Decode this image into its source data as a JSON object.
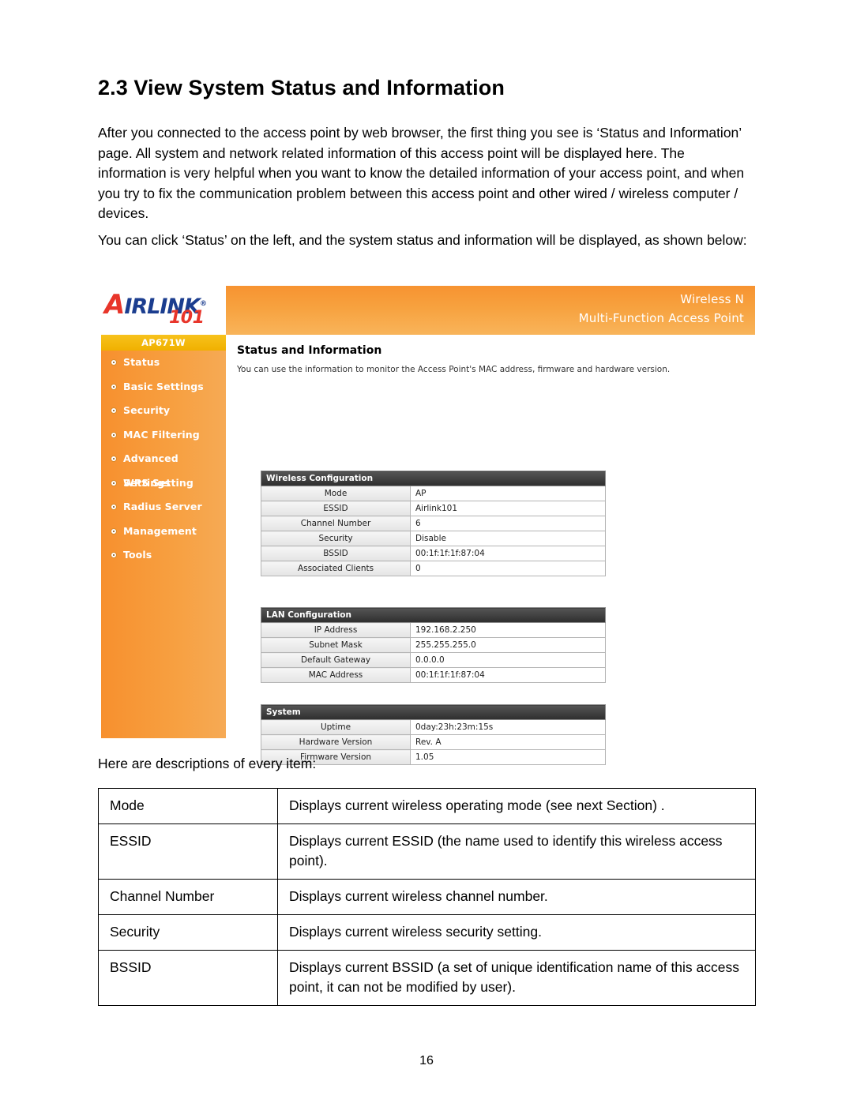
{
  "document": {
    "section_title": "2.3 View System Status and Information",
    "paragraph_1": "After you connected to the access point by web browser, the first thing you see is ‘Status and Information’ page. All system and network related information of this access point will be displayed here. The information is very helpful when you want to know the detailed information of your access point, and when you try to fix the communication problem between this access point and other wired / wireless computer / devices.",
    "paragraph_2": "You can click ‘Status’ on the left, and the system status and information will be displayed, as shown below:",
    "paragraph_3": "Here are descriptions of every item:",
    "page_number": "16"
  },
  "router_ui": {
    "logo": {
      "brand_first_letter": "A",
      "brand_rest": "IR",
      "brand_link": "LINK",
      "brand_number": "101",
      "registered": "®"
    },
    "header": {
      "line1": "Wireless N",
      "line2": "Multi-Function Access Point"
    },
    "sidebar": {
      "model": "AP671W",
      "items": [
        {
          "label": "Status"
        },
        {
          "label": "Basic Settings"
        },
        {
          "label": "Security"
        },
        {
          "label": "MAC Filtering"
        },
        {
          "label": "Advanced Settings"
        },
        {
          "label": "WPS Setting"
        },
        {
          "label": "Radius Server"
        },
        {
          "label": "Management"
        },
        {
          "label": "Tools"
        }
      ]
    },
    "content": {
      "title": "Status and Information",
      "description": "You can use the information to monitor the Access Point's MAC address, firmware and hardware version.",
      "wireless_section": "Wireless Configuration",
      "wireless_rows": [
        {
          "key": "Mode",
          "value": "AP"
        },
        {
          "key": "ESSID",
          "value": "Airlink101"
        },
        {
          "key": "Channel Number",
          "value": "6"
        },
        {
          "key": "Security",
          "value": "Disable"
        },
        {
          "key": "BSSID",
          "value": "00:1f:1f:1f:87:04"
        },
        {
          "key": "Associated Clients",
          "value": "0"
        }
      ],
      "lan_section": "LAN Configuration",
      "lan_rows": [
        {
          "key": "IP Address",
          "value": "192.168.2.250"
        },
        {
          "key": "Subnet Mask",
          "value": "255.255.255.0"
        },
        {
          "key": "Default Gateway",
          "value": "0.0.0.0"
        },
        {
          "key": "MAC Address",
          "value": "00:1f:1f:1f:87:04"
        }
      ],
      "system_section": "System",
      "system_rows": [
        {
          "key": "Uptime",
          "value": "0day:23h:23m:15s"
        },
        {
          "key": "Hardware Version",
          "value": "Rev. A"
        },
        {
          "key": "Firmware Version",
          "value": "1.05"
        }
      ]
    }
  },
  "descriptions": [
    {
      "term": "Mode",
      "text": "Displays current wireless operating mode (see next Section) ."
    },
    {
      "term": "ESSID",
      "text": "Displays current ESSID (the name used to identify this wireless access point)."
    },
    {
      "term": "Channel Number",
      "text": "Displays current wireless channel number."
    },
    {
      "term": "Security",
      "text": "Displays current wireless security setting."
    },
    {
      "term": "BSSID",
      "text": "Displays current BSSID (a set of unique identification name of this access point, it can not be modified by user)."
    }
  ]
}
